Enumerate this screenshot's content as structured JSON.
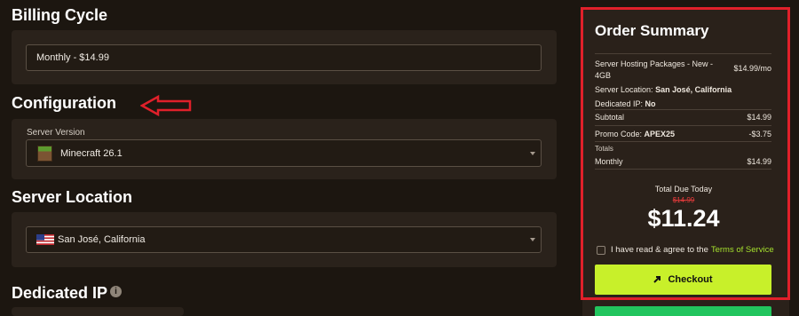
{
  "billing": {
    "title": "Billing Cycle",
    "value": "Monthly - $14.99"
  },
  "configuration": {
    "title": "Configuration",
    "server_version_label": "Server Version",
    "server_version_value": "Minecraft 26.1"
  },
  "location": {
    "title": "Server Location",
    "value": "San José, California"
  },
  "dedicated": {
    "title": "Dedicated IP"
  },
  "summary": {
    "title": "Order Summary",
    "package_name": "Server Hosting Packages - New - 4GB",
    "package_price": "$14.99/mo",
    "server_location_label": "Server Location:",
    "server_location_value": "San José, California",
    "dedicated_ip_label": "Dedicated IP:",
    "dedicated_ip_value": "No",
    "subtotal_label": "Subtotal",
    "subtotal_value": "$14.99",
    "promo_label": "Promo Code:",
    "promo_code": "APEX25",
    "promo_value": "-$3.75",
    "totals_label": "Totals",
    "monthly_label": "Monthly",
    "monthly_value": "$14.99",
    "total_due_label": "Total Due Today",
    "original_price": "$14.99",
    "total_due": "$11.24",
    "agree_text": "I have read & agree to the",
    "tos_link": "Terms of Service",
    "checkout_label": "Checkout"
  },
  "colors": {
    "accent_green": "#c8f02a",
    "link_green": "#a6e22e",
    "annotation_red": "#e0202a",
    "strike_red": "#e23a3a"
  }
}
